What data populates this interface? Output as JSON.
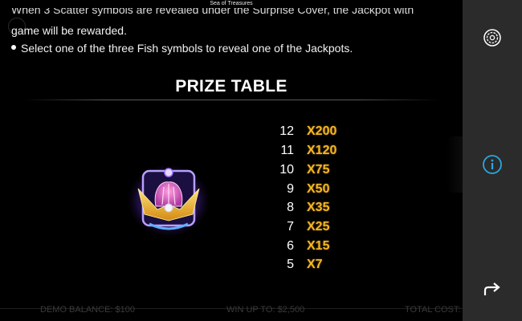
{
  "window": {
    "title": "Sea of Treasures"
  },
  "rules": {
    "line_cut": "When 3 Scatter symbols are revealed under the Surprise Cover, the Jackpot with",
    "line_game": "game will be rewarded.",
    "bullet_text": "Select one of the three Fish symbols to reveal one of the Jackpots."
  },
  "prize_table": {
    "title": "PRIZE TABLE",
    "symbol_icon": "pearl-shell-icon",
    "rows": [
      {
        "count": "12",
        "multiplier": "X200"
      },
      {
        "count": "11",
        "multiplier": "X120"
      },
      {
        "count": "10",
        "multiplier": "X75"
      },
      {
        "count": "9",
        "multiplier": "X50"
      },
      {
        "count": "8",
        "multiplier": "X35"
      },
      {
        "count": "7",
        "multiplier": "X25"
      },
      {
        "count": "6",
        "multiplier": "X15"
      },
      {
        "count": "5",
        "multiplier": "X7"
      }
    ]
  },
  "footer": {
    "balance": "DEMO BALANCE: $100",
    "win": "WIN UP TO: $2,500",
    "total": "TOTAL COST: $"
  },
  "sidebar": {
    "settings_icon": "gear-icon",
    "info_icon": "info-icon",
    "back_icon": "return-arrow-icon"
  },
  "colors": {
    "multiplier": "#f2b624",
    "info_accent": "#2aa8e0",
    "sidebar_bg": "#2b2b2b"
  }
}
